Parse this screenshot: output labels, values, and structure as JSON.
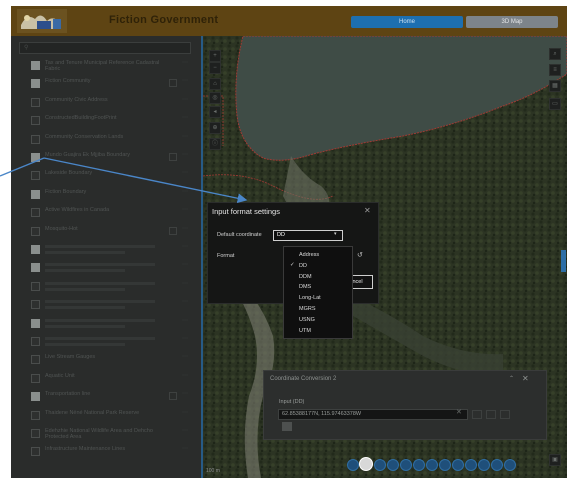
{
  "header": {
    "title": "Fiction Government",
    "home_label": "Home",
    "three_d_label": "3D Map"
  },
  "sidebar": {
    "layers": [
      {
        "label": "Tax and Tenure Municipal Reference Cadastral Fabric",
        "checked": true,
        "menu": true
      },
      {
        "label": "Fiction Community",
        "checked": true,
        "menu": true,
        "extra_icon": true
      },
      {
        "label": "Community Civic Address",
        "checked": false,
        "menu": true
      },
      {
        "label": "ConstructedBuildingFootPrint",
        "checked": false,
        "menu": true
      },
      {
        "label": "Community Conservation Lands",
        "checked": false,
        "menu": true
      },
      {
        "label": "Mundo Guajira Ek Mjjiba Boundary",
        "checked": true,
        "menu": true,
        "extra_icon": true
      },
      {
        "label": "Lakeside Boundary",
        "checked": false,
        "menu": true
      },
      {
        "label": "Fiction Boundary",
        "checked": true,
        "menu": true
      },
      {
        "label": "Active Wildfires in Canada",
        "checked": false,
        "menu": true
      },
      {
        "label": "Mosquito-Hot",
        "checked": false,
        "menu": true,
        "extra_icon": true
      },
      {
        "label": "",
        "checked": true,
        "menu": true
      },
      {
        "label": "",
        "checked": true,
        "menu": true
      },
      {
        "label": "",
        "checked": false,
        "menu": true
      },
      {
        "label": "",
        "checked": false,
        "menu": true
      },
      {
        "label": "",
        "checked": true,
        "menu": true
      },
      {
        "label": "",
        "checked": false,
        "menu": true
      },
      {
        "label": "Live Stream Gauges",
        "checked": false,
        "menu": true
      },
      {
        "label": "Aquatic Unit",
        "checked": false,
        "menu": true
      },
      {
        "label": "Transportation line",
        "checked": true,
        "menu": true,
        "extra_icon": true
      },
      {
        "label": "Thaidene Nëné National Park Reserve",
        "checked": false,
        "menu": true
      },
      {
        "label": "Edehzhie National Wildlife Area and Dehcho Protected Area",
        "checked": false,
        "menu": true
      },
      {
        "label": "Infrastructure Maintenance Lines",
        "checked": false,
        "menu": true
      }
    ]
  },
  "dialog": {
    "title": "Input format settings",
    "default_coordinate_label": "Default coordinate",
    "selected_value": "DD",
    "format_label": "Format",
    "cancel_label": "Cancel"
  },
  "dropdown": {
    "options": [
      "Address",
      "DD",
      "DDM",
      "DMS",
      "Long-Lat",
      "MGRS",
      "USNG",
      "UTM"
    ],
    "selected": "DD"
  },
  "coordinate_conversion": {
    "title": "Coordinate Conversion 2",
    "input_label": "Input (DD)",
    "input_value": "62.85388177N, 115.97463378W"
  },
  "map": {
    "scale_text": "100 m"
  }
}
